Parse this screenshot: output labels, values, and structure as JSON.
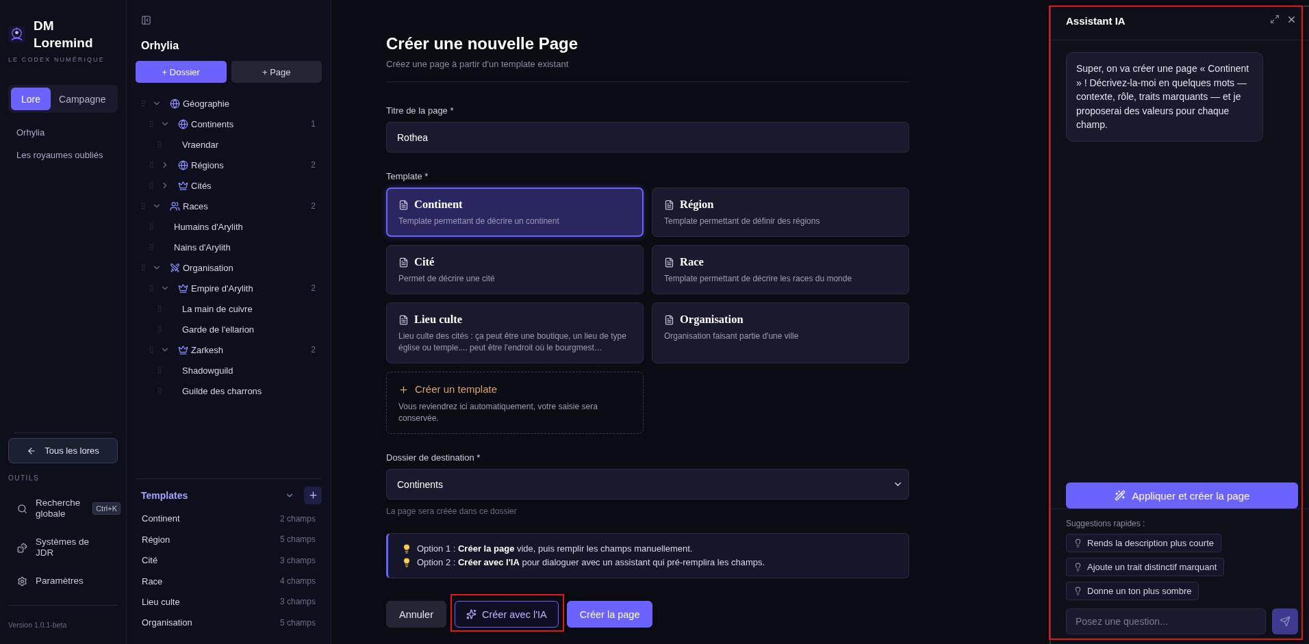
{
  "sidebar": {
    "brand": {
      "name": "DM Loremind",
      "tagline": "LE CODEX NUMÉRIQUE"
    },
    "mode_tabs": [
      {
        "label": "Lore",
        "selected": true
      },
      {
        "label": "Campagne",
        "selected": false
      }
    ],
    "lores": [
      {
        "label": "Orhylia"
      },
      {
        "label": "Les royaumes oubliés"
      }
    ],
    "back_button": "Tous les lores",
    "tools_heading": "OUTILS",
    "tools": [
      {
        "label": "Recherche globale",
        "shortcut": "Ctrl+K"
      },
      {
        "label": "Systèmes de JDR"
      },
      {
        "label": "Paramètres"
      }
    ],
    "version": "Version 1.0.1-beta"
  },
  "explorer": {
    "title": "Orhylia",
    "buttons": [
      {
        "label": "+ Dossier",
        "kind": "primary"
      },
      {
        "label": "+ Page",
        "kind": "secondary"
      }
    ],
    "tree": [
      {
        "label": "Géographie",
        "kind": "globe",
        "expanded": true,
        "children": [
          {
            "label": "Continents",
            "kind": "globe",
            "expanded": true,
            "count": "1",
            "children": [
              {
                "label": "Vraendar",
                "kind": "page"
              }
            ]
          },
          {
            "label": "Régions",
            "kind": "globe",
            "expanded": false,
            "count": "2"
          },
          {
            "label": "Cités",
            "kind": "crown",
            "expanded": false
          }
        ]
      },
      {
        "label": "Races",
        "kind": "people",
        "expanded": true,
        "count": "2",
        "children": [
          {
            "label": "Humains d'Arylith",
            "kind": "page"
          },
          {
            "label": "Nains d'Arylith",
            "kind": "page"
          }
        ]
      },
      {
        "label": "Organisation",
        "kind": "swords",
        "expanded": true,
        "children": [
          {
            "label": "Empire d'Arylith",
            "kind": "crown",
            "expanded": true,
            "count": "2",
            "children": [
              {
                "label": "La main de cuivre",
                "kind": "page"
              },
              {
                "label": "Garde de l'ellarion",
                "kind": "page"
              }
            ]
          },
          {
            "label": "Zarkesh",
            "kind": "crown",
            "expanded": true,
            "count": "2",
            "children": [
              {
                "label": "Shadowguild",
                "kind": "page"
              },
              {
                "label": "Guilde des charrons",
                "kind": "page"
              }
            ]
          }
        ]
      }
    ],
    "templates": {
      "title": "Templates",
      "expanded": true,
      "items": [
        {
          "name": "Continent",
          "fields": "2 champs"
        },
        {
          "name": "Région",
          "fields": "5 champs"
        },
        {
          "name": "Cité",
          "fields": "3 champs"
        },
        {
          "name": "Race",
          "fields": "4 champs"
        },
        {
          "name": "Lieu culte",
          "fields": "3 champs"
        },
        {
          "name": "Organisation",
          "fields": "5 champs"
        }
      ]
    }
  },
  "form": {
    "title": "Créer une nouvelle Page",
    "subtitle": "Créez une page à partir d'un template existant",
    "page_title": {
      "label": "Titre de la page *",
      "value": "Rothea"
    },
    "template": {
      "label": "Template *",
      "options": [
        {
          "title": "Continent",
          "description": "Template permettant de décrire un continent",
          "selected": true
        },
        {
          "title": "Région",
          "description": "Template permettant de définir des régions",
          "selected": false
        },
        {
          "title": "Cité",
          "description": "Permet de décrire une cité",
          "selected": false
        },
        {
          "title": "Race",
          "description": "Template permettant de décrire les races du monde",
          "selected": false
        },
        {
          "title": "Lieu culte",
          "description": "Lieu culte des cités : ça peut être une boutique, un lieu de type église ou temple.... peut être l'endroit où le bourgmest…",
          "selected": false
        },
        {
          "title": "Organisation",
          "description": "Organisation faisant partie d'une ville",
          "selected": false
        }
      ],
      "create": {
        "title": "Créer un template",
        "description": "Vous reviendrez ici automatiquement, votre saisie sera conservée."
      }
    },
    "destination": {
      "label": "Dossier de destination *",
      "value": "Continents",
      "hint": "La page sera créée dans ce dossier"
    },
    "info": [
      "Option 1 : **Créer la page** vide, puis remplir les champs manuellement.",
      "Option 2 : **Créer avec l'IA** pour dialoguer avec un assistant qui pré-remplira les champs."
    ],
    "buttons": [
      {
        "label": "Annuler",
        "kind": "secondary",
        "highlighted": false
      },
      {
        "label": "Créer avec l'IA",
        "kind": "ai",
        "highlighted": true
      },
      {
        "label": "Créer la page",
        "kind": "primary",
        "highlighted": false
      }
    ]
  },
  "assistant": {
    "title": "Assistant IA",
    "highlighted": true,
    "messages": [
      "Super, on va créer une page « Continent » ! Décrivez-la-moi en quelques mots — contexte, rôle, traits marquants — et je proposerai des valeurs pour chaque champ."
    ],
    "apply_button": "Appliquer et créer la page",
    "suggestions_label": "Suggestions rapides :",
    "suggestions": [
      "Rends la description plus courte",
      "Ajoute un trait distinctif marquant",
      "Donne un ton plus sombre"
    ],
    "input": {
      "placeholder": "Posez une question..."
    },
    "send_button": {
      "disabled": true
    }
  }
}
